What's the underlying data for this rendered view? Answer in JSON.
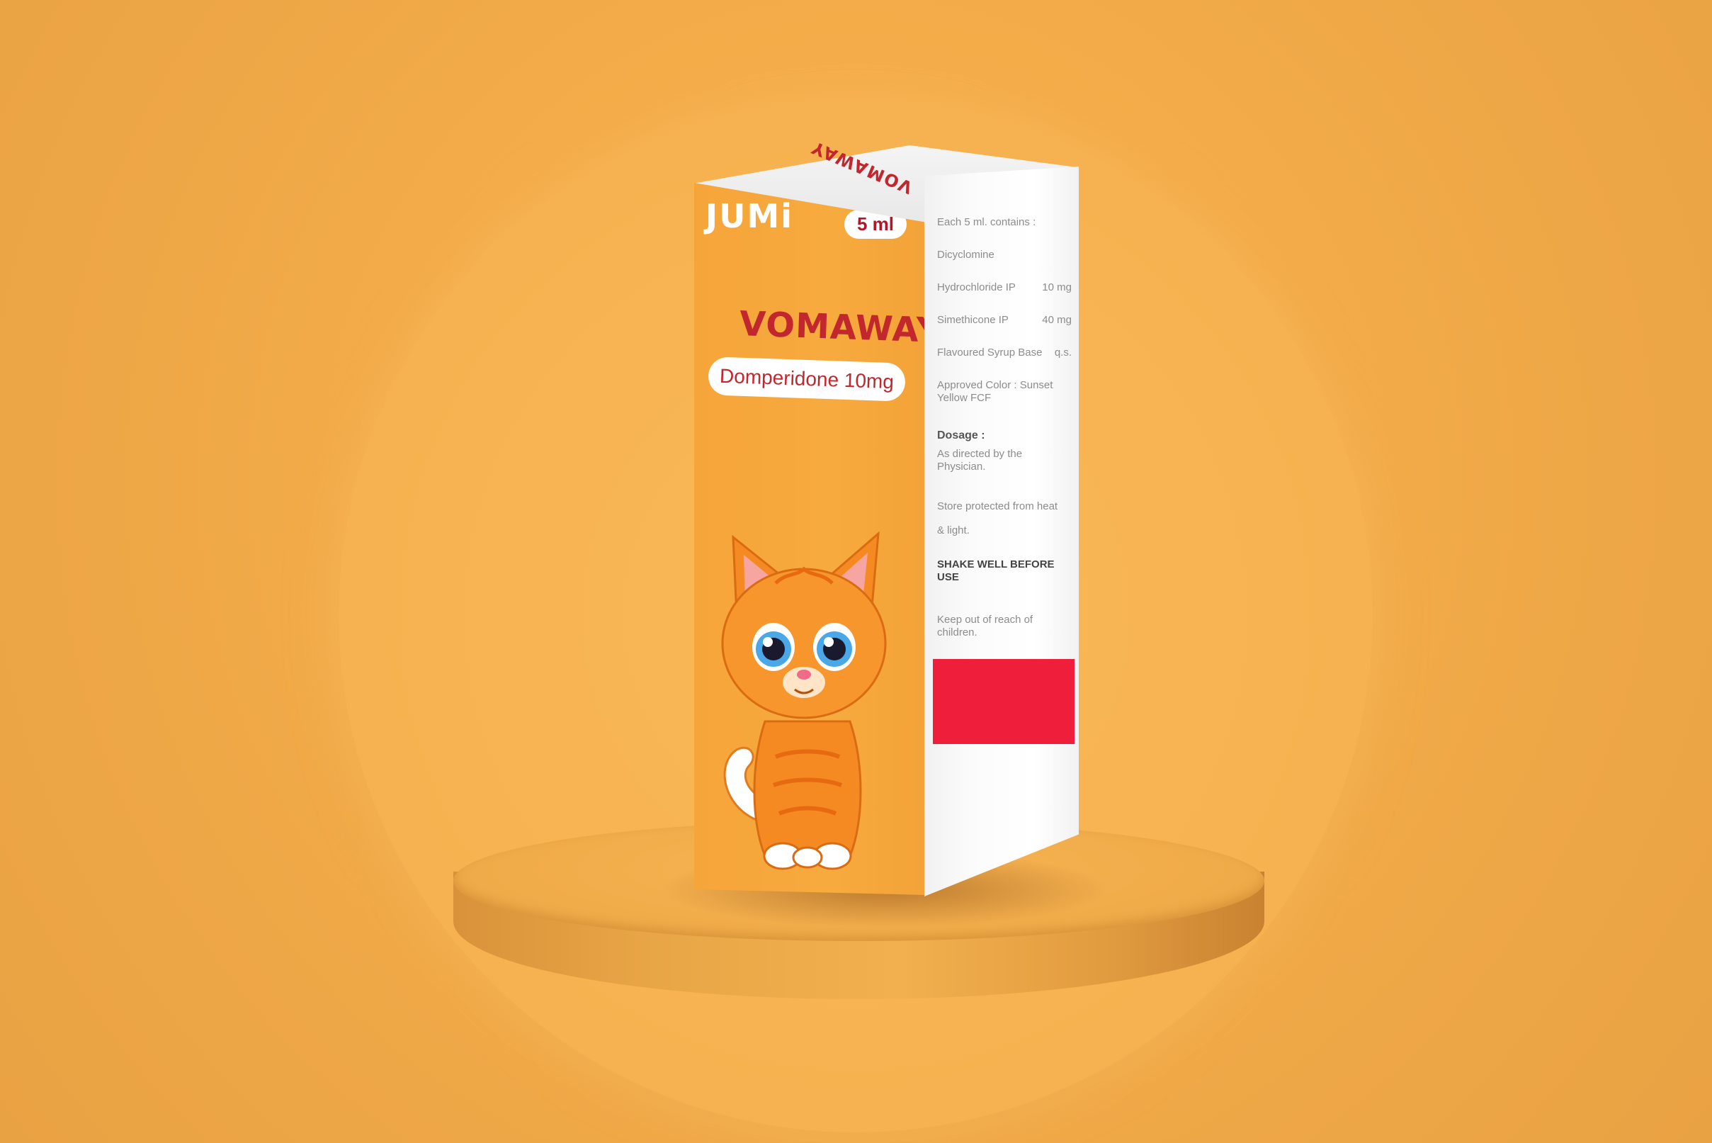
{
  "package": {
    "brand": "JUMi",
    "volume": "5 ml",
    "product_name": "VOMAWAY",
    "generic_name": "Domperidone 10mg",
    "top_print": "VOMAWAY"
  },
  "side_panel": {
    "contains_heading": "Each 5 ml. contains :",
    "ingredients": [
      {
        "name": "Dicyclomine",
        "amount": ""
      },
      {
        "name": "Hydrochloride IP",
        "amount": "10 mg"
      },
      {
        "name": "Simethicone IP",
        "amount": "40 mg"
      },
      {
        "name": "Flavoured Syrup Base",
        "amount": "q.s."
      },
      {
        "name": "Approved Color : Sunset Yellow FCF",
        "amount": ""
      }
    ],
    "dosage_label": "Dosage :",
    "dosage_text": "As directed by the Physician.",
    "storage_line1": "Store protected from heat",
    "storage_line2": "& light.",
    "shake_warning": "SHAKE WELL BEFORE USE",
    "children_warning": "Keep out of reach of children."
  },
  "colors": {
    "background": "#f5ad4a",
    "box_front": "#f7aa3e",
    "accent_red": "#c1272d",
    "label_red": "#ef1f3b"
  },
  "icons": {
    "mascot": "orange-kitten-illustration"
  }
}
